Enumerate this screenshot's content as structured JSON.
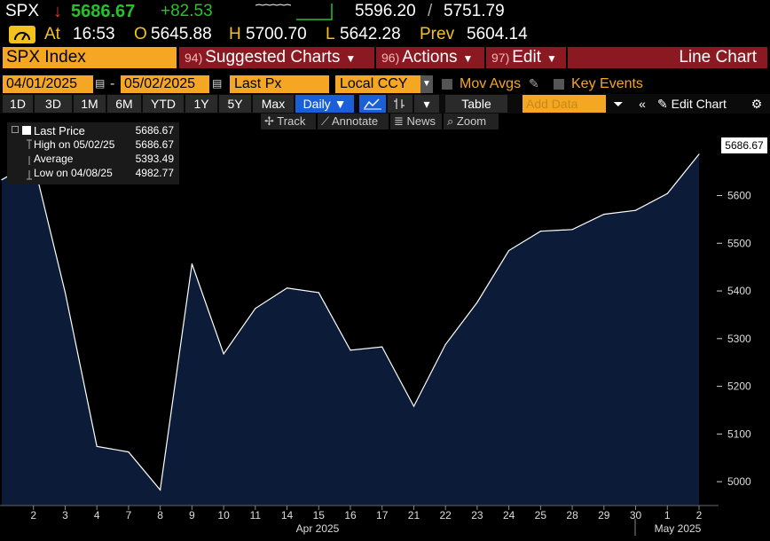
{
  "quote": {
    "ticker": "SPX",
    "direction_icon": "down-arrow-icon",
    "last": "5686.67",
    "change": "+82.53",
    "bid": "5596.20",
    "separator": "/",
    "ask": "5751.79",
    "at_label": "At",
    "time": "16:53",
    "open_label": "O",
    "open": "5645.88",
    "high_label": "H",
    "high": "5700.70",
    "low_label": "L",
    "low": "5642.28",
    "prev_label": "Prev",
    "prev": "5604.14"
  },
  "command_bar": {
    "security": "SPX Index",
    "menus": [
      {
        "num": "94)",
        "label": "Suggested Charts"
      },
      {
        "num": "96)",
        "label": "Actions"
      },
      {
        "num": "97)",
        "label": "Edit"
      }
    ],
    "chart_type": "Line Chart"
  },
  "range": {
    "start": "04/01/2025",
    "separator": "-",
    "end": "05/02/2025",
    "field": "Last Px",
    "currency": "Local CCY",
    "options": [
      "Mov Avgs",
      "Key Events"
    ]
  },
  "toolbar": {
    "periods": [
      "1D",
      "3D",
      "1M",
      "6M",
      "YTD",
      "1Y",
      "5Y",
      "Max"
    ],
    "frequency": "Daily ▼",
    "table_label": "Table",
    "add_data_placeholder": "Add Data",
    "edit_chart": "Edit Chart"
  },
  "subbar": {
    "track": "Track",
    "annotate": "Annotate",
    "news": "News",
    "zoom": "Zoom"
  },
  "legend": {
    "last_label": "Last Price",
    "last_value": "5686.67",
    "high_label": "High on 05/02/25",
    "high_value": "5686.67",
    "avg_label": "Average",
    "avg_value": "5393.49",
    "low_label": "Low on 04/08/25",
    "low_value": "4982.77"
  },
  "colors": {
    "orange": "#f5a623",
    "menu_red": "#8a1922",
    "green": "#27c12c",
    "area_fill": "#0c1c38"
  },
  "chart_data": {
    "type": "area",
    "x": [
      "1",
      "2",
      "3",
      "4",
      "7",
      "8",
      "9",
      "10",
      "11",
      "14",
      "15",
      "16",
      "17",
      "21",
      "22",
      "23",
      "24",
      "25",
      "28",
      "29",
      "30",
      "1",
      "2"
    ],
    "values": [
      5633.07,
      5670.97,
      5396.52,
      5074.08,
      5062.25,
      4982.77,
      5456.9,
      5268.05,
      5363.36,
      5405.97,
      5396.63,
      5275.7,
      5282.7,
      5158.2,
      5287.76,
      5375.86,
      5484.77,
      5525.21,
      5528.75,
      5560.83,
      5569.06,
      5604.14,
      5686.67
    ],
    "month_labels": [
      "Apr 2025",
      "May 2025"
    ],
    "y_ticks": [
      5000,
      5100,
      5200,
      5300,
      5400,
      5500,
      5600,
      5700
    ],
    "ylim": [
      4950,
      5720
    ]
  }
}
